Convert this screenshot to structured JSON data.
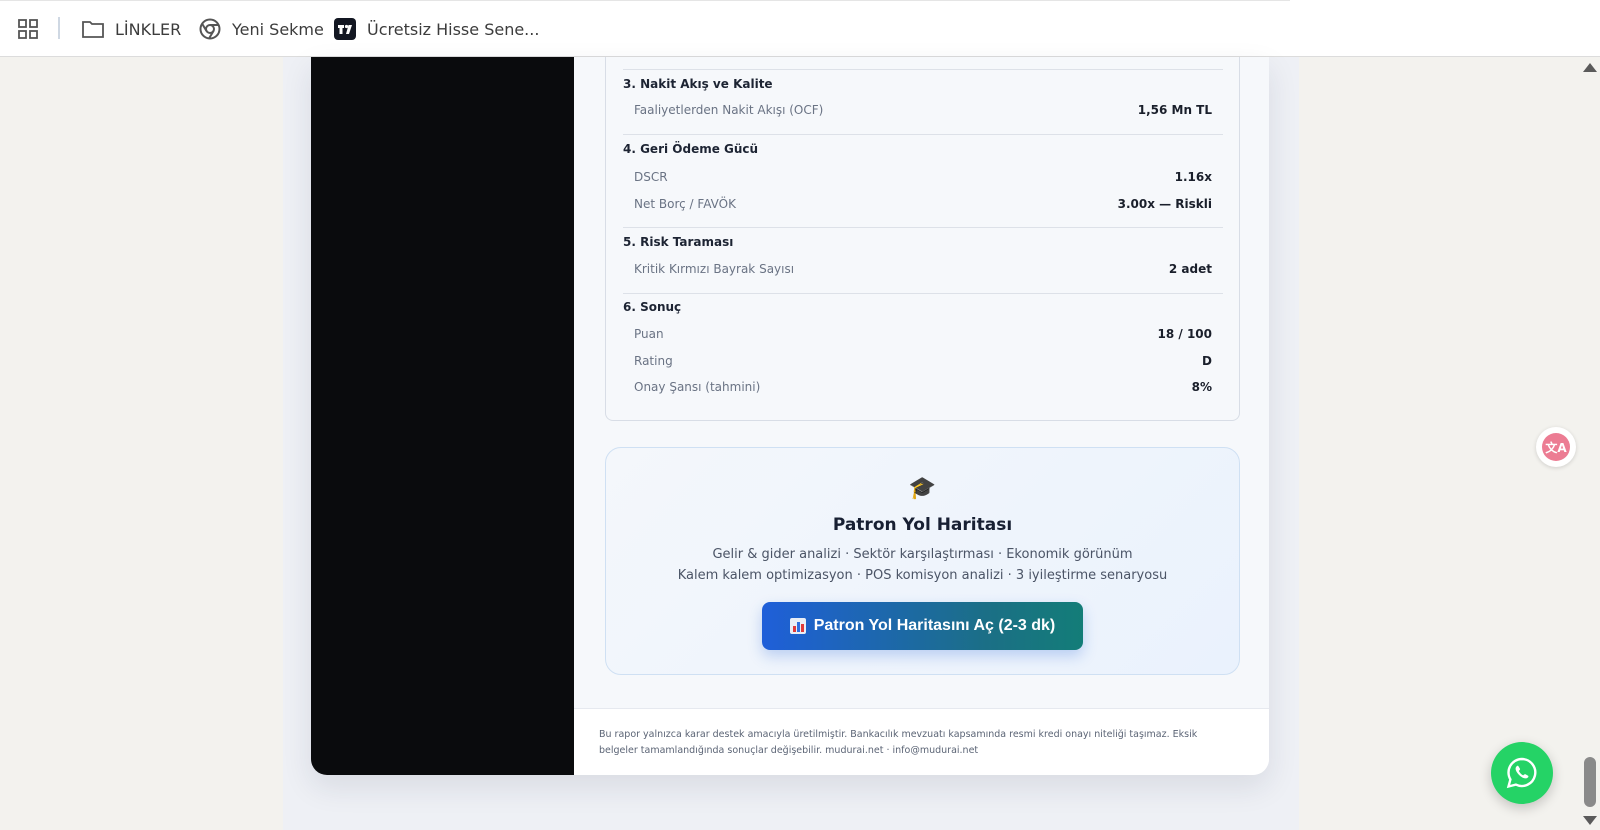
{
  "bookmarks": {
    "items": [
      {
        "label": "LİNKLER",
        "icon": "folder-icon"
      },
      {
        "label": "Yeni Sekme",
        "icon": "chrome-icon"
      },
      {
        "label": "Ücretsiz Hisse Sene...",
        "icon": "tradingview-icon"
      }
    ]
  },
  "report": {
    "sections": [
      {
        "title": "3. Nakit Akış ve Kalite",
        "rows": [
          {
            "label": "Faaliyetlerden Nakit Akışı (OCF)",
            "value": "1,56 Mn TL"
          }
        ]
      },
      {
        "title": "4. Geri Ödeme Gücü",
        "rows": [
          {
            "label": "DSCR",
            "value": "1.16x"
          },
          {
            "label": "Net Borç / FAVÖK",
            "value": "3.00x — Riskli"
          }
        ]
      },
      {
        "title": "5. Risk Taraması",
        "rows": [
          {
            "label": "Kritik Kırmızı Bayrak Sayısı",
            "value": "2 adet"
          }
        ]
      },
      {
        "title": "6. Sonuç",
        "rows": [
          {
            "label": "Puan",
            "value": "18 / 100"
          },
          {
            "label": "Rating",
            "value": "D"
          },
          {
            "label": "Onay Şansı (tahmini)",
            "value": "8%"
          }
        ]
      }
    ]
  },
  "promo": {
    "icon": "🎓",
    "title": "Patron Yol Haritası",
    "line1": "Gelir & gider analizi · Sektör karşılaştırması · Ekonomik görünüm",
    "line2": "Kalem kalem optimizasyon · POS komisyon analizi · 3 iyileştirme senaryosu",
    "cta_label": "Patron Yol Haritasını Aç (2-3 dk)"
  },
  "footer": {
    "text": "Bu rapor yalnızca karar destek amacıyla üretilmiştir. Bankacılık mevzuatı kapsamında resmi kredi onayı niteliği taşımaz. Eksik belgeler tamamlandığında sonuçlar değişebilir. mudurai.net · info@mudurai.net"
  },
  "widgets": {
    "translate_label": "文A"
  },
  "colors": {
    "cta_start": "#1f5fd9",
    "cta_end": "#137d78",
    "whatsapp": "#25d366"
  }
}
